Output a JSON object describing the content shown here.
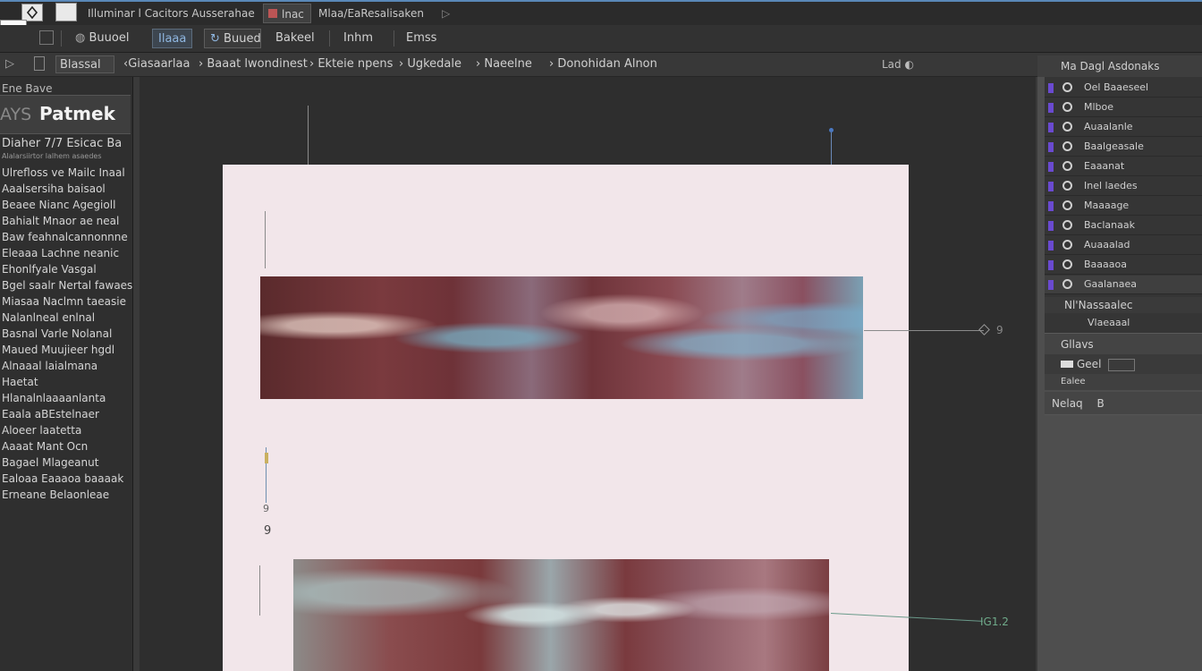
{
  "tabs": {
    "tab1": "Illuminar l Cacitors Ausserahae",
    "tab2": "lnac",
    "tab3": "Mlaa/EaResalisaken"
  },
  "toolbar": {
    "items": [
      "Buuoel",
      "Ilaaa",
      "Buued",
      "Bakeel",
      "Inhm",
      "Emss"
    ]
  },
  "options": {
    "items": [
      "Blassal",
      "Giasaarlaa",
      "Baaat lwondinest",
      "Ekteie npens",
      "Ugkedale",
      "Naeelne",
      "Donohidan Alnon"
    ],
    "zoom": "Lad"
  },
  "left_panel": {
    "header": "Ene Bave",
    "title": "Patmek",
    "title_prefix": "AYS",
    "subheading": "Diaher 7/7 Esicac Ba",
    "subnote": "Alalarsiirtor lalhem asaedes",
    "lines": [
      "Ulrefloss ve Mailc Inaal",
      "Aaalsersiha baisaol",
      "Beaee Nianc Agegioll",
      "Bahialt Mnaor ae neal",
      "Baw feahnalcannonnne",
      "Eleaaa Lachne neanic",
      "Ehonlfyale Vasgal",
      "Bgel saalr Nertal fawaes",
      "Miasaa Naclmn taeasie",
      "Nalanlneal enlnal",
      "Basnal Varle Nolanal",
      "Maued Muujieer hgdl",
      "Alnaaal laialmana",
      "Haetat",
      "Hlanalnlaaaanlanta",
      "Eaala aBEstelnaer",
      "Aloeer laatetta",
      "Aaaat Mant Ocn",
      "Bagael Mlageanut",
      "Ealoaa Eaaaoa baaaak",
      "Erneane Belaonleae"
    ]
  },
  "canvas_markers": {
    "marker1": "9",
    "marker2": "9",
    "callout1": "9",
    "callout2": "IG1.2"
  },
  "right_panel": {
    "header": "Ma Dagl Asdonaks",
    "layers": [
      "Oel Baaeseel",
      "Mlboe",
      "Auaalanle",
      "Baalgeasale",
      "Eaaanat",
      "Inel laedes",
      "Maaaage",
      "Baclanaak",
      "Auaaalad",
      "Baaaaoa",
      "Gaalanaea"
    ],
    "group_label": "Nl'Nassaalec",
    "group_sub": "Vlaeaaal",
    "field1": "Gllavs",
    "field2": "Geel",
    "field3": "Ealee",
    "field4_label": "Nelaq",
    "field4_value": "B"
  },
  "colors": {
    "accent": "#5a88b8",
    "layer_chip": "#6a4ad0",
    "canvas_bg": "#2e2e2e",
    "page_bg": "#f2e6ea"
  }
}
